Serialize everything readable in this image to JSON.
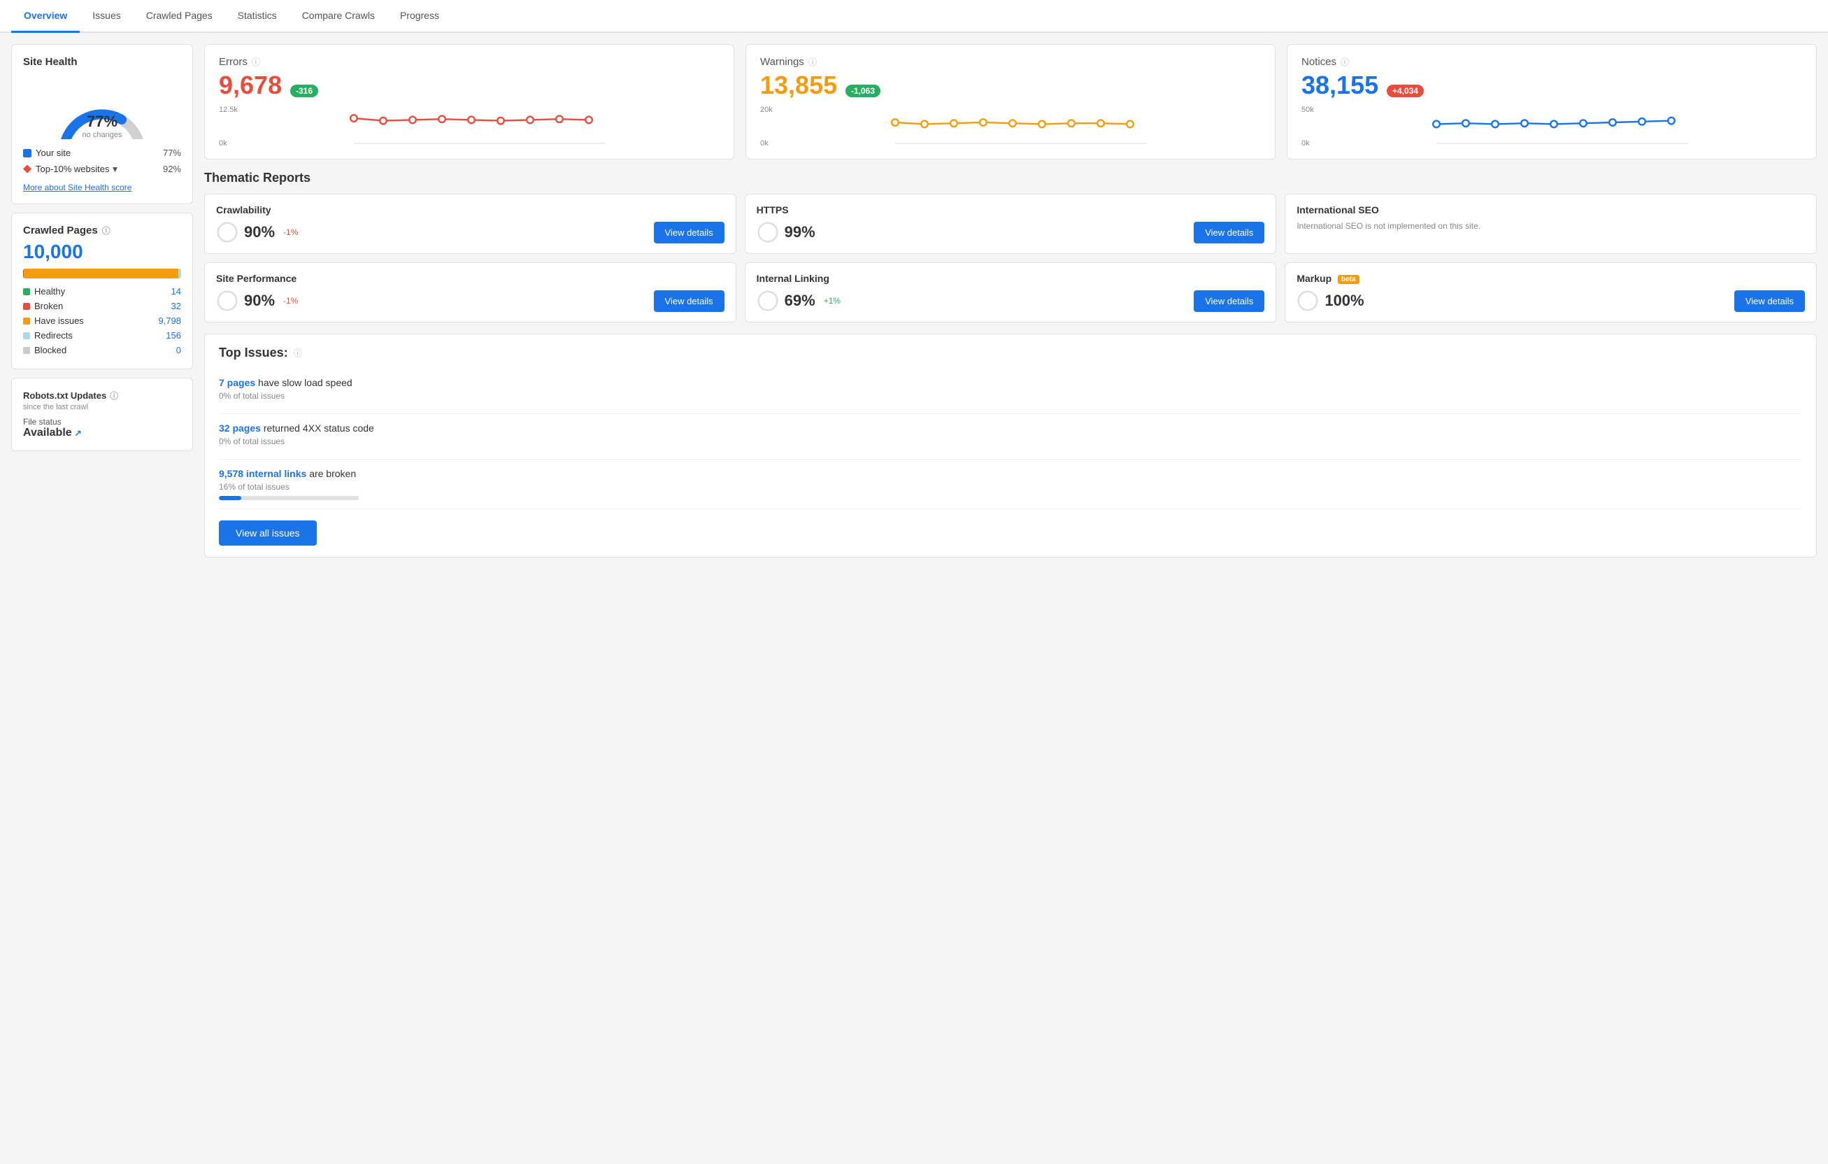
{
  "tabs": [
    {
      "label": "Overview",
      "active": true
    },
    {
      "label": "Issues",
      "active": false
    },
    {
      "label": "Crawled Pages",
      "active": false
    },
    {
      "label": "Statistics",
      "active": false
    },
    {
      "label": "Compare Crawls",
      "active": false
    },
    {
      "label": "Progress",
      "active": false
    }
  ],
  "siteHealth": {
    "title": "Site Health",
    "percent": "77%",
    "label": "no changes",
    "yourSite": {
      "label": "Your site",
      "value": "77%",
      "color": "#1a73e8"
    },
    "topSites": {
      "label": "Top-10% websites",
      "value": "92%",
      "color": "#e74c3c"
    },
    "moreLink": "More about Site Health score"
  },
  "crawledPages": {
    "title": "Crawled Pages",
    "count": "10,000",
    "bar": [
      {
        "color": "#27ae60",
        "pct": 0.14
      },
      {
        "color": "#e74c3c",
        "pct": 0.32
      },
      {
        "color": "#f39c12",
        "pct": 97.98
      },
      {
        "color": "#add8e6",
        "pct": 1.56
      },
      {
        "color": "#ccc",
        "pct": 0
      }
    ],
    "stats": [
      {
        "label": "Healthy",
        "value": "14",
        "color": "#27ae60"
      },
      {
        "label": "Broken",
        "value": "32",
        "color": "#e74c3c"
      },
      {
        "label": "Have issues",
        "value": "9,798",
        "color": "#f39c12"
      },
      {
        "label": "Redirects",
        "value": "156",
        "color": "#add8e6"
      },
      {
        "label": "Blocked",
        "value": "0",
        "color": "#ccc"
      }
    ]
  },
  "robots": {
    "title": "Robots.txt Updates",
    "subtitle": "since the last crawl",
    "fileStatusLabel": "File status",
    "fileStatusValue": "Available"
  },
  "errors": {
    "label": "Errors",
    "value": "9,678",
    "badge": "-316",
    "badgeColor": "green",
    "color": "red",
    "chartMax": "12.5k",
    "chartMin": "0k"
  },
  "warnings": {
    "label": "Warnings",
    "value": "13,855",
    "badge": "-1,063",
    "badgeColor": "green",
    "color": "orange",
    "chartMax": "20k",
    "chartMin": "0k"
  },
  "notices": {
    "label": "Notices",
    "value": "38,155",
    "badge": "+4,034",
    "badgeColor": "red",
    "color": "blue",
    "chartMax": "50k",
    "chartMin": "0k"
  },
  "thematicReports": {
    "title": "Thematic Reports",
    "reports": [
      {
        "title": "Crawlability",
        "score": "90%",
        "change": "-1%",
        "changeType": "neg",
        "hasDetails": true,
        "note": "",
        "beta": false,
        "scoreNum": 90
      },
      {
        "title": "HTTPS",
        "score": "99%",
        "change": "",
        "changeType": "",
        "hasDetails": true,
        "note": "",
        "beta": false,
        "scoreNum": 99
      },
      {
        "title": "International SEO",
        "score": "",
        "change": "",
        "changeType": "",
        "hasDetails": false,
        "note": "International SEO is not implemented on this site.",
        "beta": false,
        "scoreNum": 0
      },
      {
        "title": "Site Performance",
        "score": "90%",
        "change": "-1%",
        "changeType": "neg",
        "hasDetails": true,
        "note": "",
        "beta": false,
        "scoreNum": 90
      },
      {
        "title": "Internal Linking",
        "score": "69%",
        "change": "+1%",
        "changeType": "pos",
        "hasDetails": true,
        "note": "",
        "beta": false,
        "scoreNum": 69
      },
      {
        "title": "Markup",
        "score": "100%",
        "change": "",
        "changeType": "",
        "hasDetails": true,
        "note": "",
        "beta": true,
        "scoreNum": 100
      }
    ],
    "viewDetailsLabel": "View details"
  },
  "topIssues": {
    "title": "Top Issues:",
    "issues": [
      {
        "linkText": "7 pages",
        "description": "have slow load speed",
        "sub": "0% of total issues",
        "progress": 0
      },
      {
        "linkText": "32 pages",
        "description": "returned 4XX status code",
        "sub": "0% of total issues",
        "progress": 0
      },
      {
        "linkText": "9,578 internal links",
        "description": "are broken",
        "sub": "16% of total issues",
        "progress": 16
      }
    ],
    "viewAllLabel": "View all issues"
  }
}
